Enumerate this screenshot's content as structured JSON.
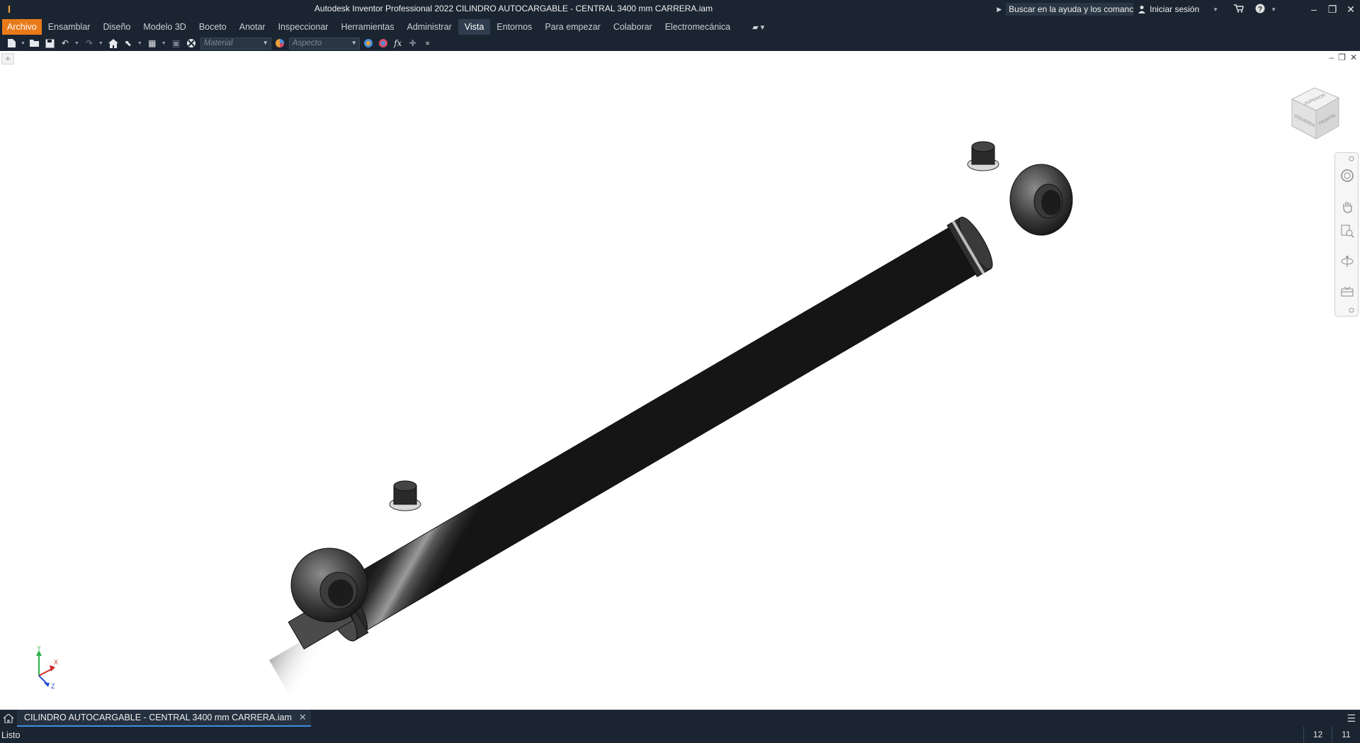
{
  "titlebar": {
    "app_logo_letter": "I",
    "title": "Autodesk Inventor Professional 2022    CILINDRO AUTOCARGABLE - CENTRAL 3400 mm CARRERA.iam",
    "search_text": "Buscar en la ayuda y los comanc",
    "signin_label": "Iniciar sesión"
  },
  "menu": {
    "items": [
      {
        "label": "Archivo"
      },
      {
        "label": "Ensamblar"
      },
      {
        "label": "Diseño"
      },
      {
        "label": "Modelo 3D"
      },
      {
        "label": "Boceto"
      },
      {
        "label": "Anotar"
      },
      {
        "label": "Inspeccionar"
      },
      {
        "label": "Herramientas"
      },
      {
        "label": "Administrar"
      },
      {
        "label": "Vista"
      },
      {
        "label": "Entornos"
      },
      {
        "label": "Para empezar"
      },
      {
        "label": "Colaborar"
      },
      {
        "label": "Electromecánica"
      }
    ],
    "active": "Vista"
  },
  "quick_access": {
    "material_placeholder": "Material",
    "appearance_placeholder": "Aspecto",
    "fx_label": "fx"
  },
  "viewcube": {
    "top_face": "SUPERIOR",
    "front_face": "FRONTAL",
    "left_face": "IZQUIERDA"
  },
  "triad": {
    "x_label": "X",
    "y_label": "Y",
    "z_label": "Z"
  },
  "doc_tabs": {
    "active_doc": "CILINDRO AUTOCARGABLE - CENTRAL 3400 mm CARRERA.iam"
  },
  "status": {
    "text": "Listo",
    "count_a": "12",
    "count_b": "11"
  },
  "colors": {
    "chrome": "#1b2532",
    "file_tab": "#e97a19",
    "active_doc_underline": "#3f8fe0"
  }
}
